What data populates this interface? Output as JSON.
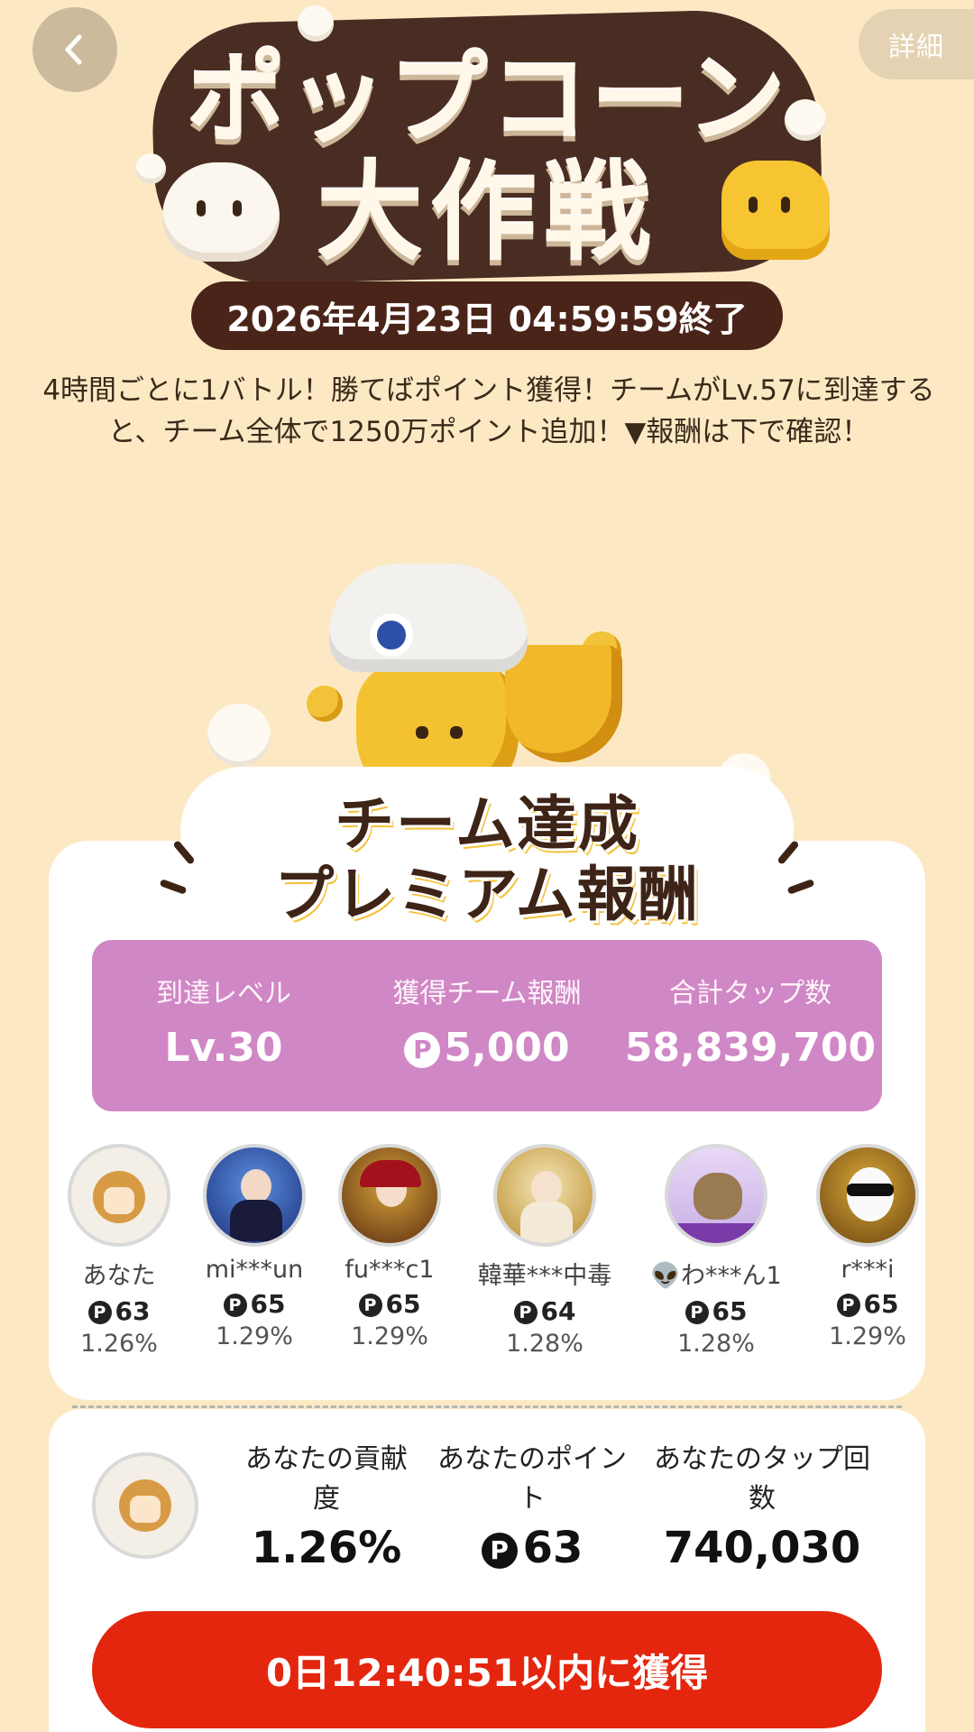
{
  "header": {
    "details_label": "詳細",
    "title_line1": "ポップコーン",
    "title_line2": "大作戦",
    "end_time": "2026年4月23日 04:59:59終了"
  },
  "description": "4時間ごとに1バトル！勝てばポイント獲得！チームがLv.57に到達すると、チーム全体で1250万ポイント追加！▼報酬は下で確認！",
  "card": {
    "title_line1": "チーム達成",
    "title_line2": "プレミアム報酬",
    "stats": {
      "level_label": "到達レベル",
      "level_value": "Lv.30",
      "reward_label": "獲得チーム報酬",
      "reward_value": "5,000",
      "taps_label": "合計タップ数",
      "taps_value": "58,839,700"
    },
    "members": [
      {
        "name": "あなた",
        "points": "63",
        "percent": "1.26%",
        "avatar": "mascot-avatar"
      },
      {
        "name": "mi***un",
        "points": "65",
        "percent": "1.29%",
        "avatar": "anime-avatar"
      },
      {
        "name": "fu***c1",
        "points": "65",
        "percent": "1.29%",
        "avatar": "anime-avatar"
      },
      {
        "name": "韓華***中毒",
        "points": "64",
        "percent": "1.28%",
        "avatar": "anime-avatar"
      },
      {
        "name": "👽わ***ん1",
        "points": "65",
        "percent": "1.28%",
        "avatar": "cat-avatar"
      },
      {
        "name": "r***i",
        "points": "65",
        "percent": "1.29%",
        "avatar": "dog-avatar"
      }
    ]
  },
  "me": {
    "contribution_label": "あなたの貢献度",
    "contribution_value": "1.26%",
    "points_label": "あなたのポイント",
    "points_value": "63",
    "taps_label": "あなたのタップ回数",
    "taps_value": "740,030"
  },
  "cta_label": "0日12:40:51以内に獲得",
  "point_symbol": "P",
  "colors": {
    "accent": "#e4260f",
    "stats_bg": "#d087c5",
    "page_bg": "#fce9c4"
  }
}
